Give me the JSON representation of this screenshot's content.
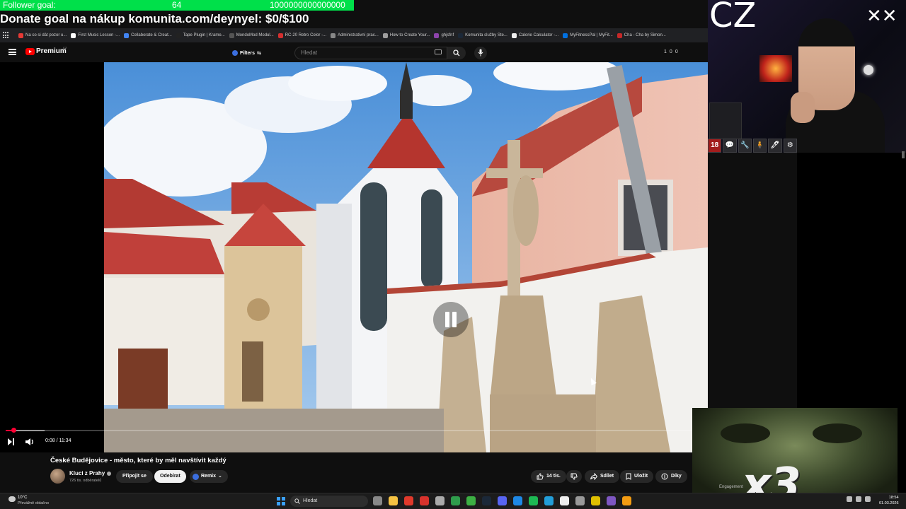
{
  "stream_overlay": {
    "follower_goal_label": "Follower goal:",
    "follower_current": "64",
    "follower_target": "1000000000000000",
    "follower_progress_fraction": 0.0,
    "donate_goal_text": "Donate goal na nákup komunita.com/deynyel: $0/$100",
    "webcam_corner_text": "CZ",
    "webcam_logo_mark": "✕✕",
    "webcam_badges": [
      "18",
      "💬",
      "🔧",
      "🧍",
      "🖊",
      "⚙"
    ],
    "emote_text": "x3"
  },
  "bookmarks": [
    {
      "label": "Na co si dát pozor u...",
      "color": "#e53935"
    },
    {
      "label": "First Music Lesson -...",
      "color": "#ffffff"
    },
    {
      "label": "Collaborate & Creat...",
      "color": "#4285f4"
    },
    {
      "label": "Tape Plugin | Krame...",
      "color": "#222222"
    },
    {
      "label": "MondoMod Modul...",
      "color": "#555555"
    },
    {
      "label": "RC-20 Retro Color -...",
      "color": "#d32f2f"
    },
    {
      "label": "Administrativní prac...",
      "color": "#888888"
    },
    {
      "label": "How to Create Your...",
      "color": "#9e9e9e"
    },
    {
      "label": "ghjsfnf",
      "color": "#8e44ad"
    },
    {
      "label": "Komunita služby Ste...",
      "color": "#1b2838"
    },
    {
      "label": "Calorie Calculator -...",
      "color": "#eeeeee"
    },
    {
      "label": "MyFitnessPal | MyFit...",
      "color": "#0070e0"
    },
    {
      "label": "Cha - Cha by Simon...",
      "color": "#c62828"
    }
  ],
  "masthead": {
    "brand": "Premium",
    "brand_region": "CZ",
    "filters_label": "Filters",
    "search_placeholder": "Hledat",
    "counter_a": "1",
    "counter_b": "0",
    "counter_c": "0"
  },
  "player": {
    "current_time": "0:08",
    "duration": "11:34",
    "time_display": "0:08 / 11:34",
    "progress_fraction": 0.0115,
    "buffer_fraction": 0.057,
    "state": "playing"
  },
  "video": {
    "title": "České Budějovice - město, které by měl navštívit každý",
    "channel_name": "Kluci z Prahy",
    "subscribers": "726 tis. odběratelů",
    "join_label": "Připojit se",
    "subscribe_label": "Odebírat",
    "remix_label": "Remix",
    "likes_label": "14 tis.",
    "share_label": "Sdílet",
    "save_label": "Uložit",
    "thanks_label": "Díky",
    "engagement_label": "Engagement"
  },
  "taskbar": {
    "weather_temp": "10°C",
    "weather_desc": "Převážně oblačno",
    "search_placeholder": "Hledat",
    "time": "18:54",
    "date": "01.03.2026",
    "apps": [
      {
        "name": "task-view",
        "color": "#888888"
      },
      {
        "name": "file-explorer",
        "color": "#f6c343"
      },
      {
        "name": "chrome",
        "color": "#e0392b"
      },
      {
        "name": "app-red",
        "color": "#d8322c"
      },
      {
        "name": "app-g",
        "color": "#aaaaaa"
      },
      {
        "name": "app-green",
        "color": "#2f9d4c"
      },
      {
        "name": "xbox",
        "color": "#3cb043"
      },
      {
        "name": "steam",
        "color": "#1b2838"
      },
      {
        "name": "discord",
        "color": "#5865f2"
      },
      {
        "name": "app-blue",
        "color": "#1e88e5"
      },
      {
        "name": "spotify",
        "color": "#1db954"
      },
      {
        "name": "telegram",
        "color": "#229ed9"
      },
      {
        "name": "notion",
        "color": "#eeeeee"
      },
      {
        "name": "app-gear",
        "color": "#999999"
      },
      {
        "name": "app-yellow",
        "color": "#e0c000"
      },
      {
        "name": "app-purple",
        "color": "#7e57c2"
      },
      {
        "name": "app-orange",
        "color": "#f39c12"
      }
    ]
  },
  "colors": {
    "goal_bar": "#00e04a",
    "youtube_red": "#ff0000",
    "progress_red": "#ff0033",
    "background": "#0f0f0f"
  }
}
